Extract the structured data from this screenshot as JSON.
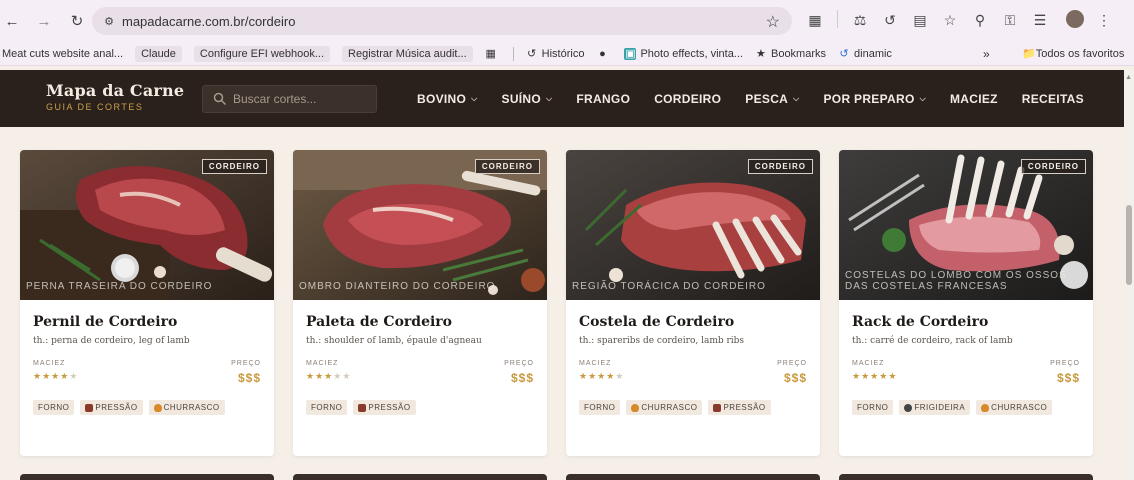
{
  "browser": {
    "url": "mapadacarne.com.br/cordeiro",
    "bookmarks": [
      {
        "label": "Meat cuts website anal...",
        "boxed": false
      },
      {
        "label": "Claude",
        "boxed": true
      },
      {
        "label": "Configure EFI webhook...",
        "boxed": true
      },
      {
        "label": "Registrar Música audit...",
        "boxed": true
      }
    ],
    "bookmarks_right": [
      {
        "label": "Histórico",
        "icon": "history-icon"
      },
      {
        "label": "",
        "icon": "globe-icon"
      },
      {
        "label": "Photo effects, vinta...",
        "icon": "photo-icon"
      },
      {
        "label": "Bookmarks",
        "icon": "star-icon"
      },
      {
        "label": "dinamic",
        "icon": "spiral-icon"
      }
    ],
    "more_label": "»",
    "all_favorites": "Todos os favoritos"
  },
  "header": {
    "brand_title": "Mapa da Carne",
    "brand_subtitle": "GUIA DE CORTES",
    "search_placeholder": "Buscar cortes...",
    "nav": [
      {
        "label": "BOVINO",
        "dropdown": true
      },
      {
        "label": "SUÍNO",
        "dropdown": true
      },
      {
        "label": "FRANGO",
        "dropdown": false
      },
      {
        "label": "CORDEIRO",
        "dropdown": false
      },
      {
        "label": "PESCA",
        "dropdown": true
      },
      {
        "label": "POR PREPARO",
        "dropdown": true
      },
      {
        "label": "MACIEZ",
        "dropdown": false
      },
      {
        "label": "RECEITAS",
        "dropdown": false
      }
    ]
  },
  "labels": {
    "maciez": "MACIEZ",
    "preco": "PREÇO"
  },
  "cards": [
    {
      "badge": "CORDEIRO",
      "caption": "PERNA TRASEIRA DO CORDEIRO",
      "title": "Pernil de Cordeiro",
      "alt": "th.: perna de cordeiro, leg of lamb",
      "tenderness": 4,
      "price": "$$$",
      "tags": [
        {
          "label": "FORNO",
          "icon": ""
        },
        {
          "label": "PRESSÃO",
          "icon": "pot-icon"
        },
        {
          "label": "CHURRASCO",
          "icon": "fire-icon"
        }
      ]
    },
    {
      "badge": "CORDEIRO",
      "caption": "OMBRO DIANTEIRO DO CORDEIRO",
      "title": "Paleta de Cordeiro",
      "alt": "th.: shoulder of lamb, épaule d'agneau",
      "tenderness": 3,
      "price": "$$$",
      "tags": [
        {
          "label": "FORNO",
          "icon": ""
        },
        {
          "label": "PRESSÃO",
          "icon": "pot-icon"
        }
      ]
    },
    {
      "badge": "CORDEIRO",
      "caption": "REGIÃO TORÁCICA DO CORDEIRO",
      "title": "Costela de Cordeiro",
      "alt": "th.: spareribs de cordeiro, lamb ribs",
      "tenderness": 4,
      "price": "$$$",
      "tags": [
        {
          "label": "FORNO",
          "icon": ""
        },
        {
          "label": "CHURRASCO",
          "icon": "fire-icon"
        },
        {
          "label": "PRESSÃO",
          "icon": "pot-icon"
        }
      ]
    },
    {
      "badge": "CORDEIRO",
      "caption": "COSTELAS DO LOMBO COM OS OSSOS DAS COSTELAS FRANCESAS",
      "title": "Rack de Cordeiro",
      "alt": "th.: carré de cordeiro, rack of lamb",
      "tenderness": 5,
      "price": "$$$",
      "tags": [
        {
          "label": "FORNO",
          "icon": ""
        },
        {
          "label": "FRIGIDEIRA",
          "icon": "pan-icon"
        },
        {
          "label": "CHURRASCO",
          "icon": "fire-icon"
        }
      ]
    }
  ],
  "colors": {
    "header_bg": "#2b211c",
    "accent_gold": "#c99a3d",
    "page_bg": "#f5efe8"
  }
}
